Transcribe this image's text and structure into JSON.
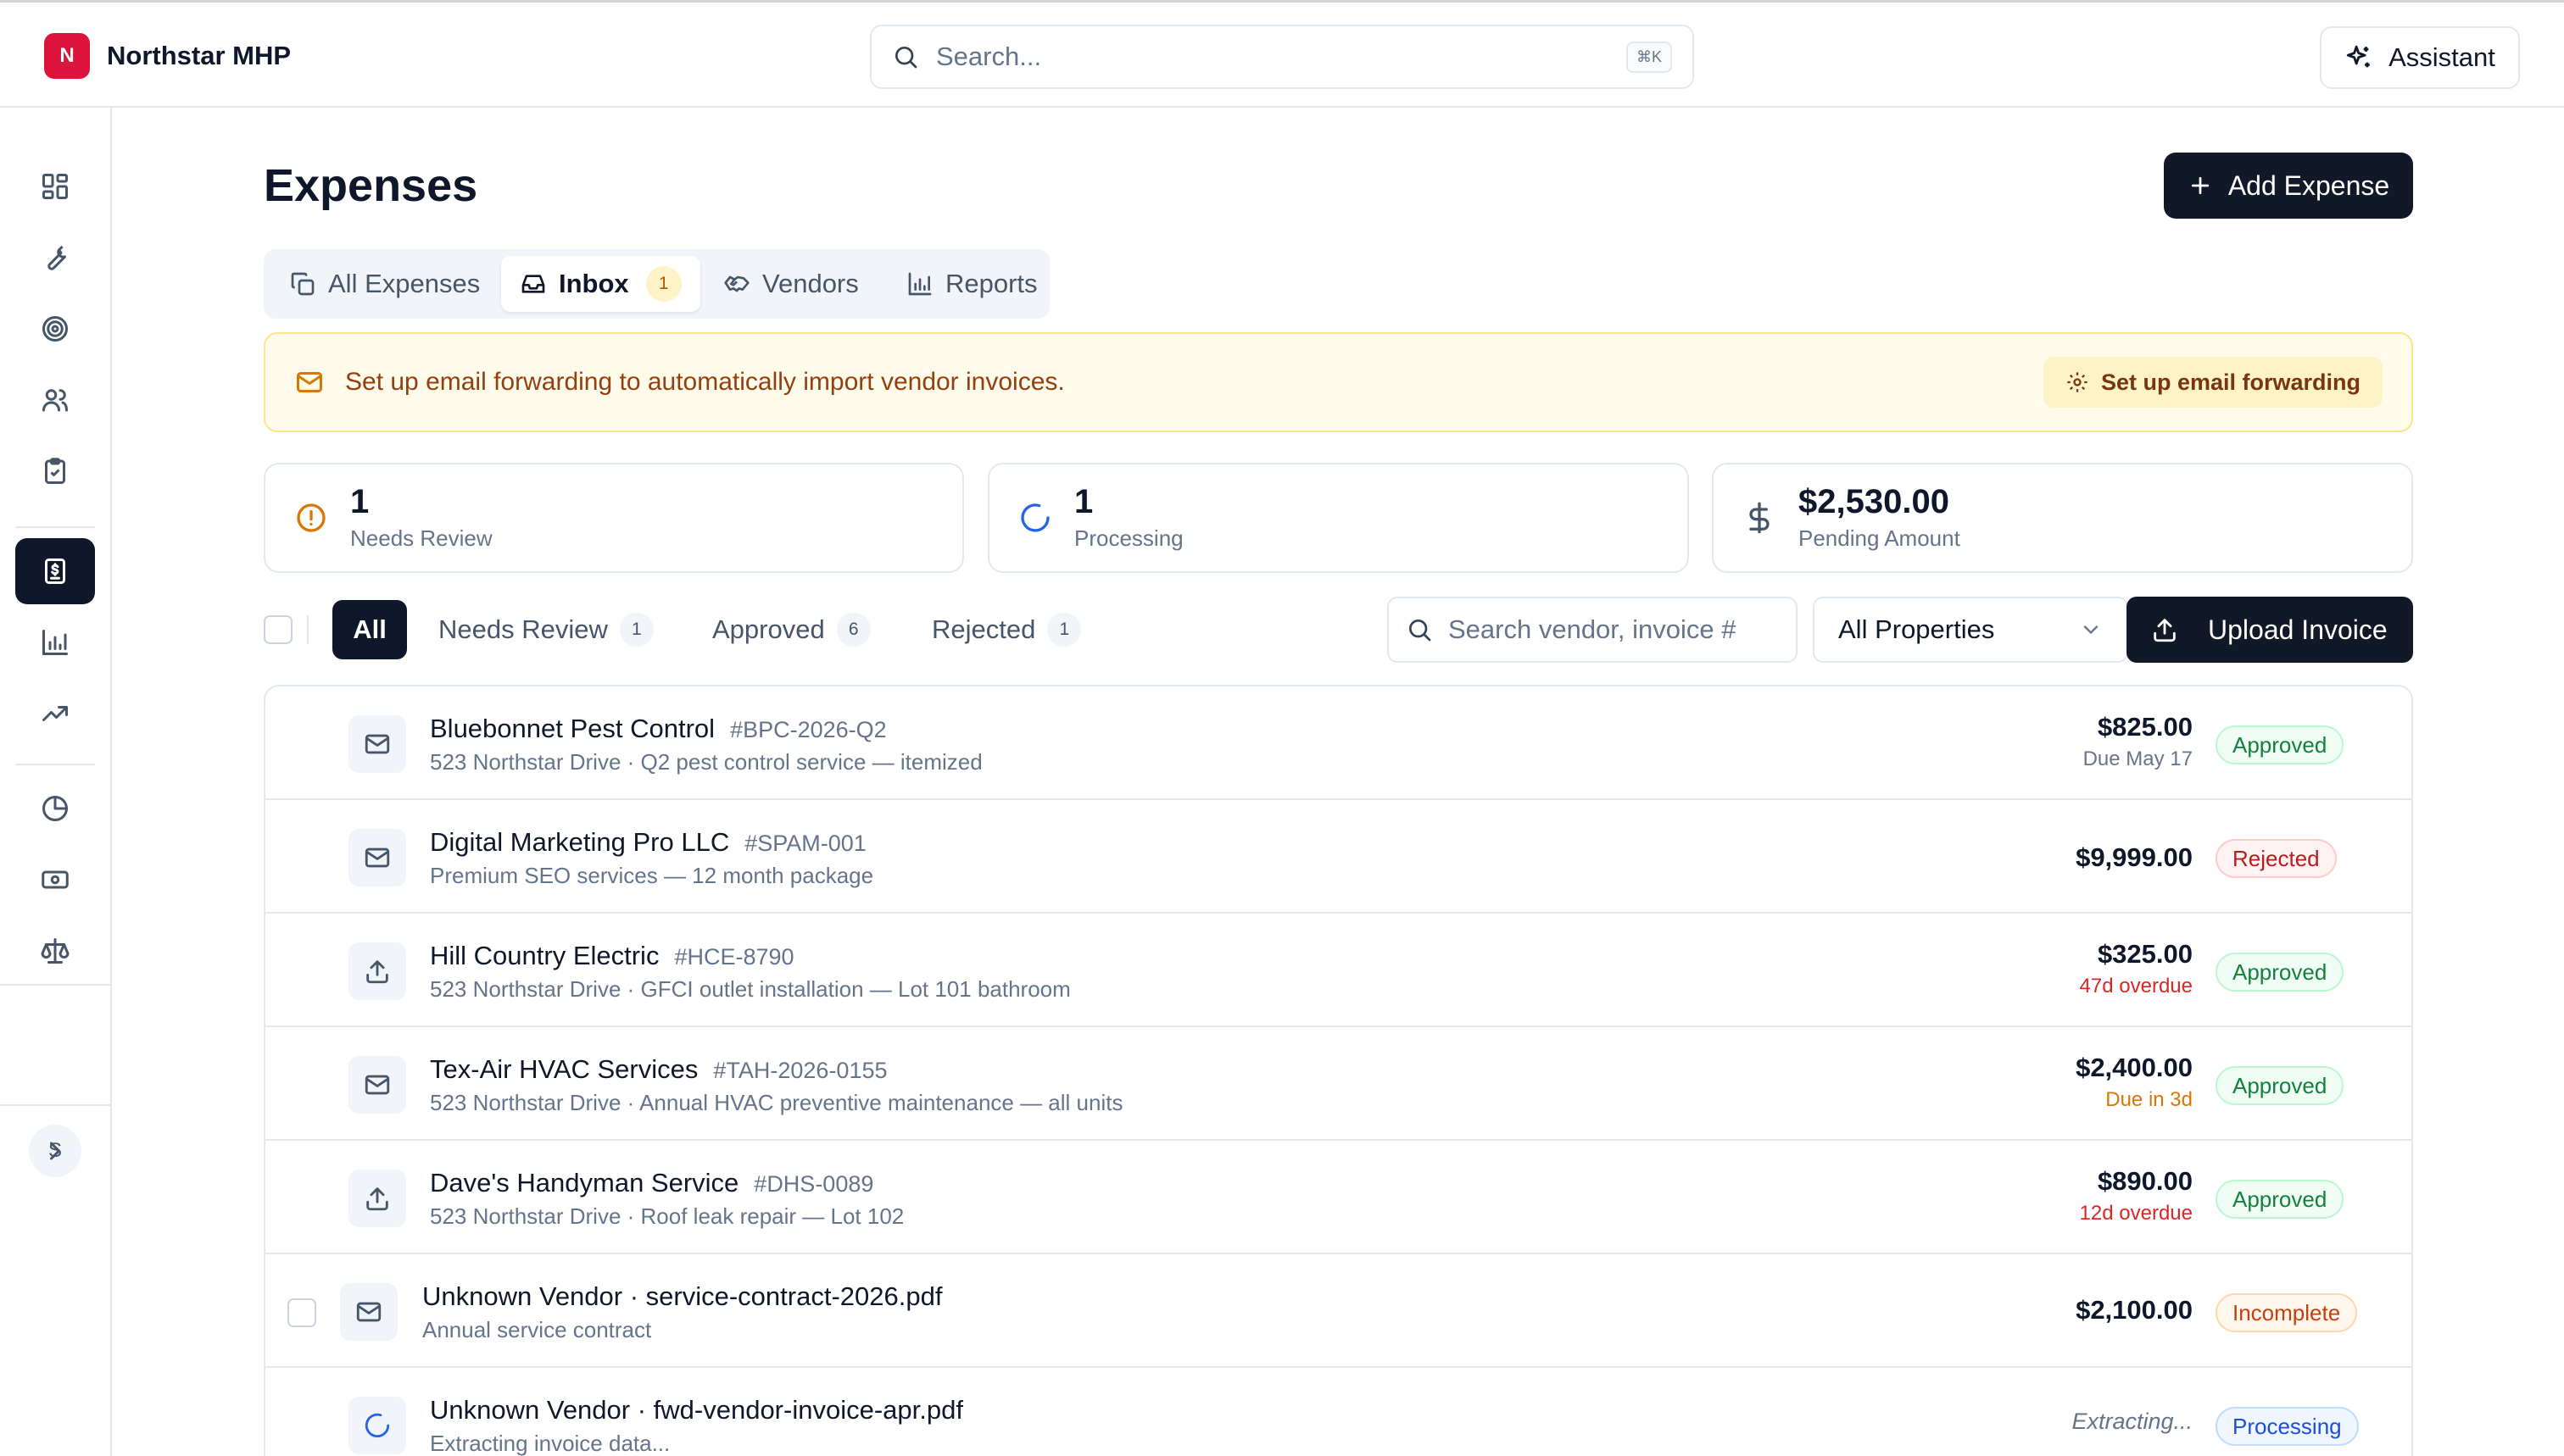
{
  "app": {
    "logo_letter": "N",
    "name": "Northstar MHP"
  },
  "search": {
    "placeholder": "Search...",
    "shortcut": "⌘K"
  },
  "assistant": {
    "label": "Assistant"
  },
  "sidebar": {
    "items": [
      {
        "icon": "dashboard-icon"
      },
      {
        "icon": "wrench-icon"
      },
      {
        "icon": "target-icon"
      },
      {
        "icon": "users-icon"
      },
      {
        "icon": "clipboard-check-icon"
      },
      {
        "icon": "receipt-dollar-icon",
        "active": true
      },
      {
        "icon": "bar-chart-icon"
      },
      {
        "icon": "trending-up-icon"
      },
      {
        "icon": "pie-chart-icon"
      },
      {
        "icon": "banknote-icon"
      },
      {
        "icon": "scale-icon"
      }
    ],
    "avatar_letter": "S",
    "expand_icon": "chevron-right-icon"
  },
  "page": {
    "title": "Expenses",
    "add_button": "Add Expense"
  },
  "tabs": [
    {
      "label": "All Expenses",
      "icon": "copy-icon"
    },
    {
      "label": "Inbox",
      "icon": "inbox-icon",
      "badge": "1",
      "active": true
    },
    {
      "label": "Vendors",
      "icon": "handshake-icon"
    },
    {
      "label": "Reports",
      "icon": "bar-chart-icon"
    }
  ],
  "banner": {
    "message": "Set up email forwarding to automatically import vendor invoices.",
    "button": "Set up email forwarding"
  },
  "stats": [
    {
      "value": "1",
      "label": "Needs Review",
      "icon": "alert-circle-icon"
    },
    {
      "value": "1",
      "label": "Processing",
      "icon": "loader-icon"
    },
    {
      "value": "$2,530.00",
      "label": "Pending Amount",
      "icon": "dollar-icon"
    }
  ],
  "filters": [
    {
      "label": "All",
      "active": true
    },
    {
      "label": "Needs Review",
      "count": "1"
    },
    {
      "label": "Approved",
      "count": "6"
    },
    {
      "label": "Rejected",
      "count": "1"
    }
  ],
  "list_search": {
    "placeholder": "Search vendor, invoice #"
  },
  "property_select": {
    "value": "All Properties"
  },
  "upload": {
    "label": "Upload Invoice"
  },
  "invoices": [
    {
      "vendor": "Bluebonnet Pest Control",
      "number": "#BPC-2026-Q2",
      "description": "523 Northstar Drive · Q2 pest control service — itemized",
      "amount": "$825.00",
      "due": "Due May 17",
      "due_tone": "gray",
      "status": "Approved",
      "source": "mail-icon"
    },
    {
      "vendor": "Digital Marketing Pro LLC",
      "number": "#SPAM-001",
      "description": "Premium SEO services — 12 month package",
      "amount": "$9,999.00",
      "due": "",
      "status": "Rejected",
      "source": "mail-icon"
    },
    {
      "vendor": "Hill Country Electric",
      "number": "#HCE-8790",
      "description": "523 Northstar Drive · GFCI outlet installation — Lot 101 bathroom",
      "amount": "$325.00",
      "due": "47d overdue",
      "due_tone": "red",
      "status": "Approved",
      "source": "upload-icon"
    },
    {
      "vendor": "Tex-Air HVAC Services",
      "number": "#TAH-2026-0155",
      "description": "523 Northstar Drive · Annual HVAC preventive maintenance — all units",
      "amount": "$2,400.00",
      "due": "Due in 3d",
      "due_tone": "amber",
      "status": "Approved",
      "source": "mail-icon"
    },
    {
      "vendor": "Dave's Handyman Service",
      "number": "#DHS-0089",
      "description": "523 Northstar Drive · Roof leak repair — Lot 102",
      "amount": "$890.00",
      "due": "12d overdue",
      "due_tone": "red",
      "status": "Approved",
      "source": "upload-icon"
    },
    {
      "vendor": "Unknown Vendor · service-contract-2026.pdf",
      "number": "",
      "description": "Annual service contract",
      "amount": "$2,100.00",
      "due": "",
      "status": "Incomplete",
      "source": "mail-icon"
    },
    {
      "vendor": "Unknown Vendor · fwd-vendor-invoice-apr.pdf",
      "number": "",
      "description": "Extracting invoice data...",
      "amount": "Extracting...",
      "due": "",
      "status": "Processing",
      "source": "loader-icon"
    }
  ],
  "colors": {
    "accent_dark": "#0f172a",
    "brand": "#dc143c",
    "banner_bg": "#fffbeb",
    "approved": "#15803d",
    "rejected": "#b91c1c",
    "incomplete": "#c2410c",
    "processing": "#1d4ed8"
  }
}
